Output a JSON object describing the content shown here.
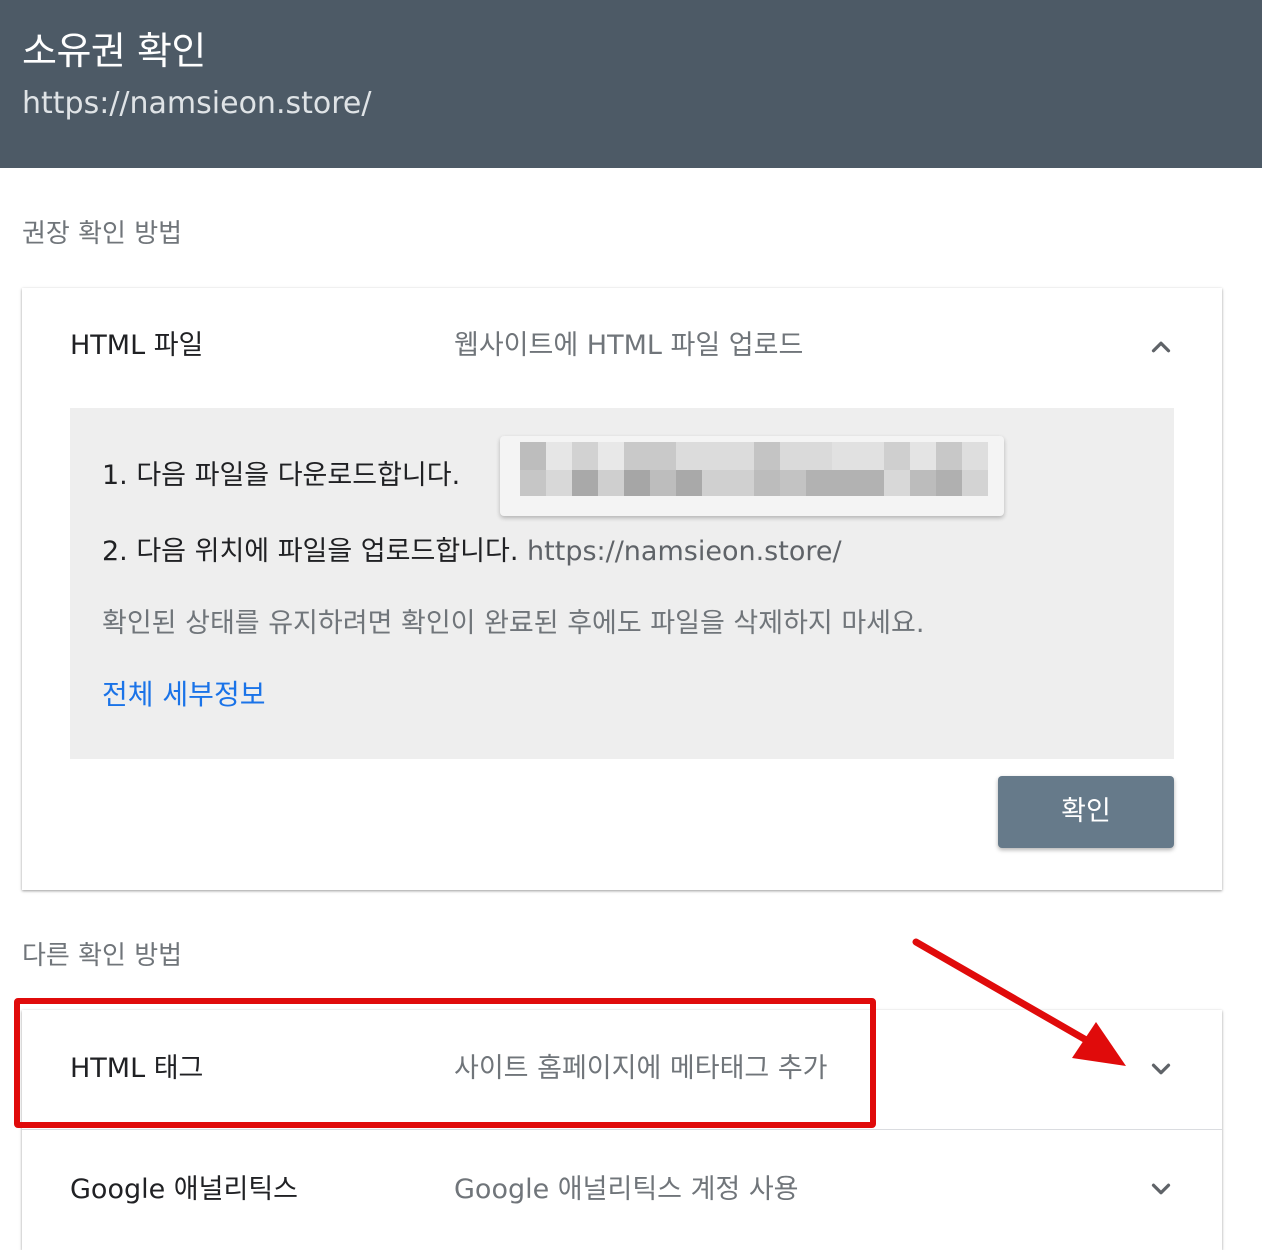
{
  "header": {
    "title": "소유권 확인",
    "url": "https://namsieon.store/"
  },
  "recommended": {
    "section_label": "권장 확인 방법",
    "method": {
      "title": "HTML 파일",
      "description": "웹사이트에 HTML 파일 업로드",
      "expanded": true,
      "step1": "1. 다음 파일을 다운로드합니다.",
      "step2": "2. 다음 위치에 파일을 업로드합니다.",
      "step2_url": "https://namsieon.store/",
      "note": "확인된 상태를 유지하려면 확인이 완료된 후에도 파일을 삭제하지 마세요.",
      "details_link": "전체 세부정보",
      "verify_button": "확인"
    }
  },
  "other": {
    "section_label": "다른 확인 방법",
    "methods": [
      {
        "title": "HTML 태그",
        "description": "사이트 홈페이지에 메타태그 추가",
        "expanded": false,
        "highlighted": true
      },
      {
        "title": "Google 애널리틱스",
        "description": "Google 애널리틱스 계정 사용",
        "expanded": false
      }
    ]
  },
  "colors": {
    "header_bg": "#4d5a66",
    "button_bg": "#667a8a",
    "link": "#1a73e8",
    "highlight": "#e00b0b"
  },
  "icons": {
    "collapse": "chevron-up-icon",
    "expand": "chevron-down-icon",
    "annotation": "red-arrow-icon"
  }
}
